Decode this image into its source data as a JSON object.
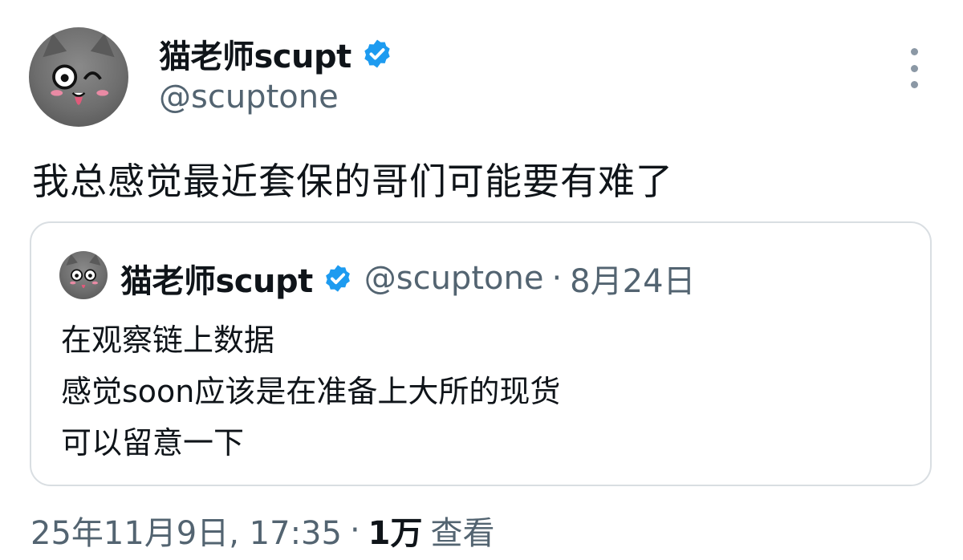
{
  "author": {
    "display_name": "猫老师scupt",
    "handle": "@scuptone",
    "verified": true,
    "avatar_icon": "cat-avatar-icon",
    "verified_icon": "verified-badge-icon",
    "accent_color": "#1d9bf0"
  },
  "tweet": {
    "text": "我总感觉最近套保的哥们可能要有难了"
  },
  "quoted": {
    "display_name": "猫老师scupt",
    "handle": "@scuptone",
    "separator": "·",
    "date": "8月24日",
    "lines": [
      "在观察链上数据",
      "感觉soon应该是在准备上大所的现货",
      "可以留意一下"
    ]
  },
  "meta": {
    "timestamp": "25年11月9日, 17:35",
    "separator": "·",
    "views_count": "1万",
    "views_label": "查看"
  },
  "menu": {
    "icon": "more-options-icon"
  }
}
